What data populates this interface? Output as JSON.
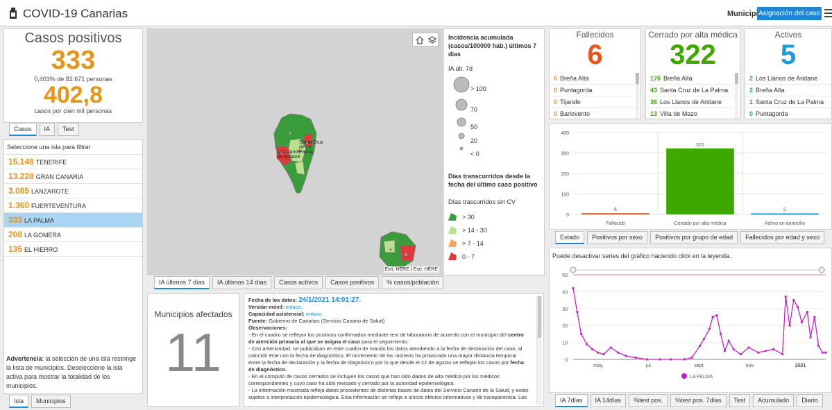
{
  "header": {
    "title": "COVID-19 Canarias",
    "municipio_label": "Municipio",
    "assign_button": "Asignación del caso"
  },
  "casos": {
    "title": "Casos positivos",
    "value": "333",
    "pct_line": "0,403% de 82.671 personas",
    "ia_value": "402,8",
    "ia_line": "casos por cien mil personas",
    "tabs": [
      "Casos",
      "IA",
      "Test"
    ]
  },
  "islands": {
    "title": "Seleccione una isla para filtrar",
    "items": [
      {
        "num": "15.148",
        "name": "TENERIFE"
      },
      {
        "num": "13.228",
        "name": "GRAN CANARIA"
      },
      {
        "num": "3.085",
        "name": "LANZAROTE"
      },
      {
        "num": "1.360",
        "name": "FUERTEVENTURA"
      },
      {
        "num": "333",
        "name": "LA PALMA"
      },
      {
        "num": "208",
        "name": "LA GOMERA"
      },
      {
        "num": "135",
        "name": "EL HIERRO"
      }
    ],
    "warning_bold": "Advertencia",
    "warning_text": ": la selección de una isla restringe la lista de municipios. Deseleccione la isla activa para mostrar la totalidad de los municipios.",
    "tabs": [
      "Isla",
      "Municipios"
    ]
  },
  "map": {
    "labels": [
      "Los Llanos de Aridane",
      "Santa Cruz de La Palma"
    ],
    "attribution": "Esri, HERE | Esri, HERE",
    "tabs": [
      "IA últimos 7 días",
      "IA últimos 14 días",
      "Casos activos",
      "Casos positivos",
      "% casos/población"
    ],
    "colors": {
      "dark_green": "#3a9c3a",
      "light_green": "#b8e08f",
      "orange": "#f4a460",
      "red": "#dd3b3b"
    }
  },
  "legend": {
    "title1": "Incidencia acumulada (casos/100000 hab.) últimos 7 días",
    "sub1": "IA últ. 7d",
    "sizes": [
      "> 100",
      "70",
      "50",
      "20",
      "< 0"
    ],
    "title2": "Días transcurridos desde la fecha del último caso positivo",
    "sub2": "Días trascurridos sin CV",
    "classes": [
      "> 30",
      "> 14 - 30",
      "> 7 - 14",
      "0 - 7"
    ]
  },
  "municipios": {
    "title": "Municipios afectados",
    "value": "11"
  },
  "notes": {
    "fecha_label": "Fecha de los datos:",
    "fecha_value": "24/1/2021 14:01:27.",
    "movil_label": "Versión móvil:",
    "movil_link": "enlace.",
    "asistencial_label": "Capacidad asistencial:",
    "asistencial_link": "enlace.",
    "fuente_label": "Fuente:",
    "fuente_value": "Gobierno de Canarias (Servicio Canario de Salud)",
    "obs_label": "Observaciones:",
    "p1a": "- En el cuadro se reflejan los positivos confirmados mediante test de laboratorio de acuerdo con el municipio del ",
    "p1b": "centro de atención primaria al que se asigna el caso",
    "p1c": " para el seguimiento.",
    "p2a": "- Con anterioridad, se publicaban en este cuadro de mando los datos atendiendo a la fecha de declaración del caso, al coincidir éste con la fecha de diagnóstico. El incremento de los rastreos ha provocado una mayor distancia temporal entre la fecha de declaración y la fecha de diagnóstico por lo que desde el 22 de agosto se reflejan los casos por ",
    "p2b": "fecha de diagnóstico.",
    "p3": "- En el cómputo de casos cerrados se incluyen los casos que han sido dados de alta médica por los médicos correspondientes y cuyo caso ha sido revisado y cerrado por la autoridad epidemiológica.",
    "p4": "- La información mostrada refleja datos procedentes de distintas bases de datos del Servicio Canario de la Salud, y están sujetos a interpretación epidemiológica. Esta información se refleja a únicos efectos informativos y de transparencia. Los"
  },
  "fallecidos": {
    "title": "Fallecidos",
    "value": "6",
    "rows": [
      {
        "n": "6",
        "name": "Breña Alta"
      },
      {
        "n": "0",
        "name": "Puntagorda"
      },
      {
        "n": "0",
        "name": "Tijarafe"
      },
      {
        "n": "0",
        "name": "Barlovento"
      }
    ]
  },
  "cerrado": {
    "title": "Cerrado por alta médica",
    "value": "322",
    "rows": [
      {
        "n": "176",
        "name": "Breña Alta"
      },
      {
        "n": "43",
        "name": "Santa Cruz de La Palma"
      },
      {
        "n": "36",
        "name": "Los Llanos de Aridane"
      },
      {
        "n": "13",
        "name": "Villa de Mazo"
      }
    ]
  },
  "activos": {
    "title": "Activos",
    "value": "5",
    "rows": [
      {
        "n": "2",
        "name": "Los Llanos de Aridane"
      },
      {
        "n": "2",
        "name": "Breña Alta"
      },
      {
        "n": "1",
        "name": "Santa Cruz de La Palma"
      },
      {
        "n": "0",
        "name": "Puntagorda"
      }
    ]
  },
  "chart_data": [
    {
      "type": "bar",
      "categories": [
        "Fallecido",
        "Cerrado por alta médica",
        "Activo en domicilio"
      ],
      "values": [
        6,
        322,
        5
      ],
      "colors": [
        "#e8541e",
        "#3ea700",
        "#1e9bd8"
      ],
      "ylim": [
        0,
        400
      ],
      "yticks": [
        0,
        100,
        200,
        300,
        400
      ]
    },
    {
      "type": "line",
      "title": "Puede desactivar series del gráfico haciendo click en la leyenda.",
      "xticks": [
        "may.",
        "jul.",
        "sept.",
        "nov.",
        "2021"
      ],
      "ylim": [
        0,
        50
      ],
      "yticks": [
        0,
        10,
        20,
        30,
        40,
        50
      ],
      "threshold": 50,
      "series": [
        {
          "name": "LA PALMA",
          "color": "#c41ec4",
          "x": [
            "2020-03-15",
            "2020-03-20",
            "2020-03-25",
            "2020-04-01",
            "2020-04-08",
            "2020-04-15",
            "2020-04-22",
            "2020-05-01",
            "2020-05-10",
            "2020-05-20",
            "2020-06-01",
            "2020-06-15",
            "2020-07-01",
            "2020-07-15",
            "2020-08-01",
            "2020-08-10",
            "2020-08-20",
            "2020-08-25",
            "2020-09-01",
            "2020-09-05",
            "2020-09-10",
            "2020-09-15",
            "2020-09-20",
            "2020-09-25",
            "2020-10-01",
            "2020-10-10",
            "2020-10-20",
            "2020-11-01",
            "2020-11-10",
            "2020-11-20",
            "2020-12-01",
            "2020-12-05",
            "2020-12-10",
            "2020-12-15",
            "2020-12-20",
            "2020-12-25",
            "2021-01-01",
            "2021-01-05",
            "2021-01-10",
            "2021-01-15",
            "2021-01-20",
            "2021-01-24"
          ],
          "values": [
            42,
            28,
            15,
            9,
            6,
            4,
            3,
            7,
            4,
            2,
            1,
            0,
            0,
            0,
            0,
            1,
            8,
            12,
            18,
            25,
            26,
            15,
            5,
            11,
            6,
            3,
            7,
            4,
            5,
            6,
            3,
            37,
            20,
            35,
            31,
            22,
            28,
            13,
            25,
            8,
            4,
            4
          ]
        }
      ]
    }
  ],
  "chart_tabs_top": [
    "Estado",
    "Positivos por sexo",
    "Positivos por grupo de edad",
    "Fallecidos por edad y sexo"
  ],
  "chart_tabs_bottom": [
    "IA 7días",
    "IA 14días",
    "%test pos.",
    "%test pos. 7días",
    "Test",
    "Acumulado",
    "Diario"
  ]
}
